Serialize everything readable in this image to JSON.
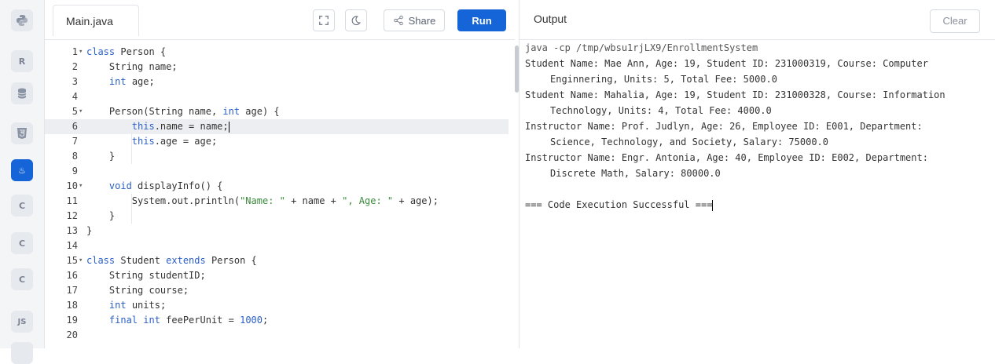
{
  "sidebar": {
    "languages": [
      {
        "name": "python",
        "label": ""
      },
      {
        "name": "r",
        "label": "R"
      },
      {
        "name": "sql",
        "label": ""
      },
      {
        "name": "html",
        "label": "5"
      },
      {
        "name": "java",
        "label": "♨"
      },
      {
        "name": "c",
        "label": "C"
      },
      {
        "name": "cpp",
        "label": "C"
      },
      {
        "name": "csharp",
        "label": "C"
      },
      {
        "name": "js",
        "label": "JS"
      }
    ]
  },
  "editor": {
    "tab_label": "Main.java",
    "share_label": "Share",
    "run_label": "Run",
    "lines": [
      {
        "n": "1",
        "fold": "▾",
        "html": "<span class=\"kw\">class</span> Person {"
      },
      {
        "n": "2",
        "fold": "",
        "html": "    String name;"
      },
      {
        "n": "3",
        "fold": "",
        "html": "    <span class=\"kw\">int</span> age;"
      },
      {
        "n": "4",
        "fold": "",
        "html": ""
      },
      {
        "n": "5",
        "fold": "▾",
        "html": "    Person(String name, <span class=\"kw\">int</span> age) {"
      },
      {
        "n": "6",
        "fold": "",
        "html": "        <span class=\"kw\">this</span>.name = name;<span class=\"caret\"></span>"
      },
      {
        "n": "7",
        "fold": "",
        "html": "        <span class=\"kw\">this</span>.age = age;"
      },
      {
        "n": "8",
        "fold": "",
        "html": "    }"
      },
      {
        "n": "9",
        "fold": "",
        "html": ""
      },
      {
        "n": "10",
        "fold": "▾",
        "html": "    <span class=\"kw\">void</span> displayInfo() {"
      },
      {
        "n": "11",
        "fold": "",
        "html": "        System.out.println(<span class=\"str\">\"Name: \"</span> + name + <span class=\"str\">\", Age: \"</span> + age);"
      },
      {
        "n": "12",
        "fold": "",
        "html": "    }"
      },
      {
        "n": "13",
        "fold": "",
        "html": "}"
      },
      {
        "n": "14",
        "fold": "",
        "html": ""
      },
      {
        "n": "15",
        "fold": "▾",
        "html": "<span class=\"kw\">class</span> Student <span class=\"kw\">extends</span> Person {"
      },
      {
        "n": "16",
        "fold": "",
        "html": "    String studentID;"
      },
      {
        "n": "17",
        "fold": "",
        "html": "    String course;"
      },
      {
        "n": "18",
        "fold": "",
        "html": "    <span class=\"kw\">int</span> units;"
      },
      {
        "n": "19",
        "fold": "",
        "html": "    <span class=\"kw\">final int</span> feePerUnit = <span class=\"num\">1000</span>;"
      },
      {
        "n": "20",
        "fold": "",
        "html": ""
      }
    ],
    "current_line": "6"
  },
  "output": {
    "title": "Output",
    "clear_label": "Clear",
    "lines": [
      {
        "t": "java -cp /tmp/wbsu1rjLX9/EnrollmentSystem",
        "cls": "cmd"
      },
      {
        "t": "Student Name: Mae Ann, Age: 19, Student ID: 231000319, Course: Computer",
        "cls": ""
      },
      {
        "t": "Enginnering, Units: 5, Total Fee: 5000.0",
        "cls": "ind"
      },
      {
        "t": "Student Name: Mahalia, Age: 19, Student ID: 231000328, Course: Information",
        "cls": ""
      },
      {
        "t": "Technology, Units: 4, Total Fee: 4000.0",
        "cls": "ind"
      },
      {
        "t": "Instructor Name: Prof. Judlyn, Age: 26, Employee ID: E001, Department:",
        "cls": ""
      },
      {
        "t": "Science, Technology, and Society, Salary: 75000.0",
        "cls": "ind"
      },
      {
        "t": "Instructor Name: Engr. Antonia, Age: 40, Employee ID: E002, Department:",
        "cls": ""
      },
      {
        "t": "Discrete Math, Salary: 80000.0",
        "cls": "ind"
      },
      {
        "t": "",
        "cls": ""
      },
      {
        "t": "=== Code Execution Successful ===",
        "cls": ""
      }
    ]
  }
}
